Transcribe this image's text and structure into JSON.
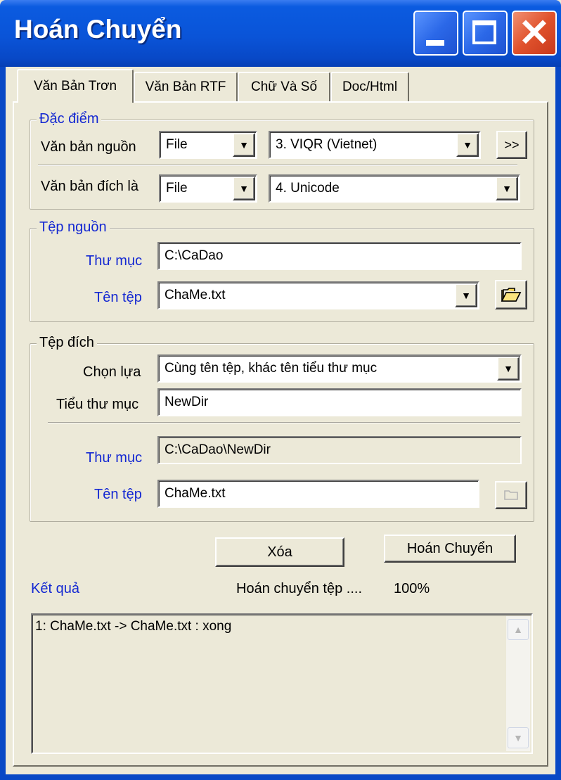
{
  "window": {
    "title": "Hoán Chuyển"
  },
  "tabs": [
    "Văn Bản Trơn",
    "Văn Bản RTF",
    "Chữ Và Số",
    "Doc/Html"
  ],
  "dac_diem": {
    "legend": "Đặc điểm",
    "source_label": "Văn bản nguồn",
    "source_type": "File",
    "source_encoding": "3. VIQR (Vietnet)",
    "more_button": ">>",
    "target_label": "Văn bản đích là",
    "target_type": "File",
    "target_encoding": "4. Unicode"
  },
  "tep_nguon": {
    "legend": "Tệp nguồn",
    "folder_label": "Thư mục",
    "folder_value": "C:\\CaDao",
    "file_label": "Tên tệp",
    "file_value": "ChaMe.txt"
  },
  "tep_dich": {
    "legend": "Tệp đích",
    "choice_label": "Chọn lựa",
    "choice_value": "Cùng tên tệp, khác tên tiểu thư mục",
    "subdir_label": "Tiểu thư mục",
    "subdir_value": "NewDir",
    "folder_label": "Thư mục",
    "folder_value": "C:\\CaDao\\NewDir",
    "file_label": "Tên tệp",
    "file_value": "ChaMe.txt"
  },
  "buttons": {
    "clear": "Xóa",
    "convert": "Hoán Chuyển"
  },
  "result": {
    "label": "Kết quả",
    "status_text": "Hoán chuyển tệp ....",
    "progress": "100%",
    "log": "1: ChaMe.txt -> ChaMe.txt : xong"
  }
}
